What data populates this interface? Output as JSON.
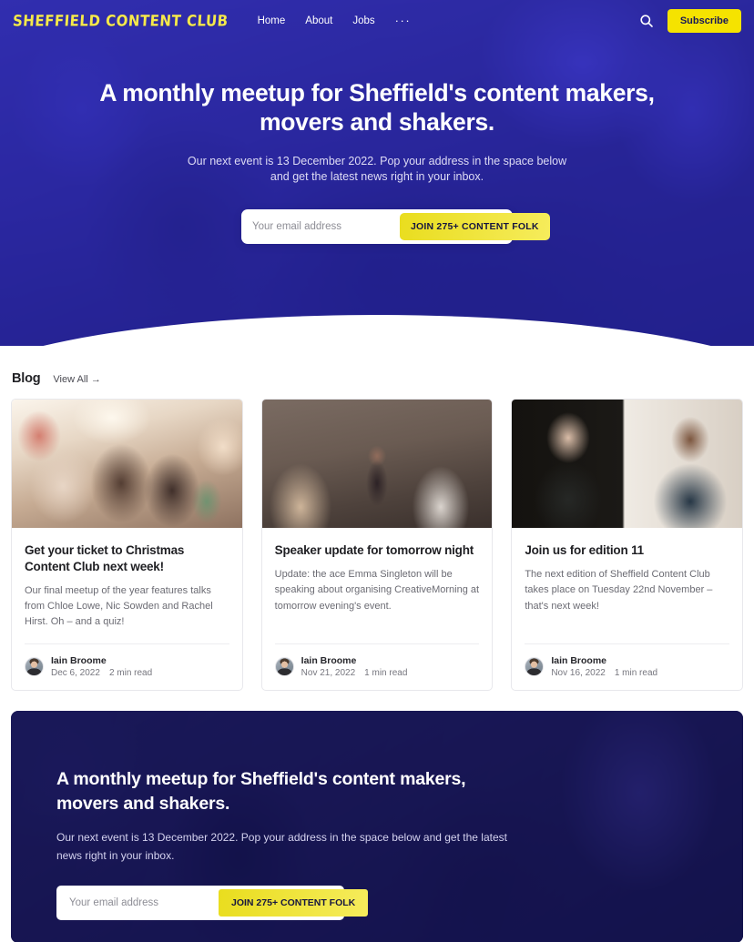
{
  "site": {
    "logo_text": "SHEFFIELD CONTENT CLUB",
    "brand_yellow": "#F5E300",
    "brand_blue": "#2D2DCD",
    "brand_navy": "#16163F"
  },
  "header": {
    "nav": [
      {
        "label": "Home"
      },
      {
        "label": "About"
      },
      {
        "label": "Jobs"
      }
    ],
    "more_label": "···",
    "search_icon": "search-icon",
    "subscribe_label": "Subscribe"
  },
  "hero": {
    "title": "A monthly meetup for Sheffield's content makers, movers and shakers.",
    "subtitle": "Our next event is 13 December 2022. Pop your address in the space below and get the latest news right in your inbox.",
    "email_placeholder": "Your email address",
    "email_value": "",
    "cta_label": "JOIN 275+ CONTENT FOLK"
  },
  "blog": {
    "heading": "Blog",
    "view_all_label": "View All",
    "view_all_icon": "arrow-right-icon",
    "posts": [
      {
        "title": "Get your ticket to Christmas Content Club next week!",
        "excerpt": "Our final meetup of the year features talks from Chloe Lowe, Nic Sowden and Rachel Hirst. Oh – and a quiz!",
        "author": "Iain Broome",
        "date": "Dec 6, 2022",
        "read_time": "2 min read",
        "image_name": "meetup-tables-photo"
      },
      {
        "title": "Speaker update for tomorrow night",
        "excerpt": "Update: the ace Emma Singleton will be speaking about organising CreativeMorning at tomorrow evening's event.",
        "author": "Iain Broome",
        "date": "Nov 21, 2022",
        "read_time": "1 min read",
        "image_name": "speaker-audience-photo"
      },
      {
        "title": "Join us for edition 11",
        "excerpt": "The next edition of Sheffield Content Club takes place on Tuesday 22nd November – that's next week!",
        "author": "Iain Broome",
        "date": "Nov 16, 2022",
        "read_time": "1 min read",
        "image_name": "two-speakers-portrait-photo"
      }
    ]
  },
  "cta": {
    "title": "A monthly meetup for Sheffield's content makers, movers and shakers.",
    "subtitle": "Our next event is 13 December 2022. Pop your address in the space below and get the latest news right in your inbox.",
    "email_placeholder": "Your email address",
    "email_value": "",
    "button_label": "JOIN 275+ CONTENT FOLK"
  }
}
